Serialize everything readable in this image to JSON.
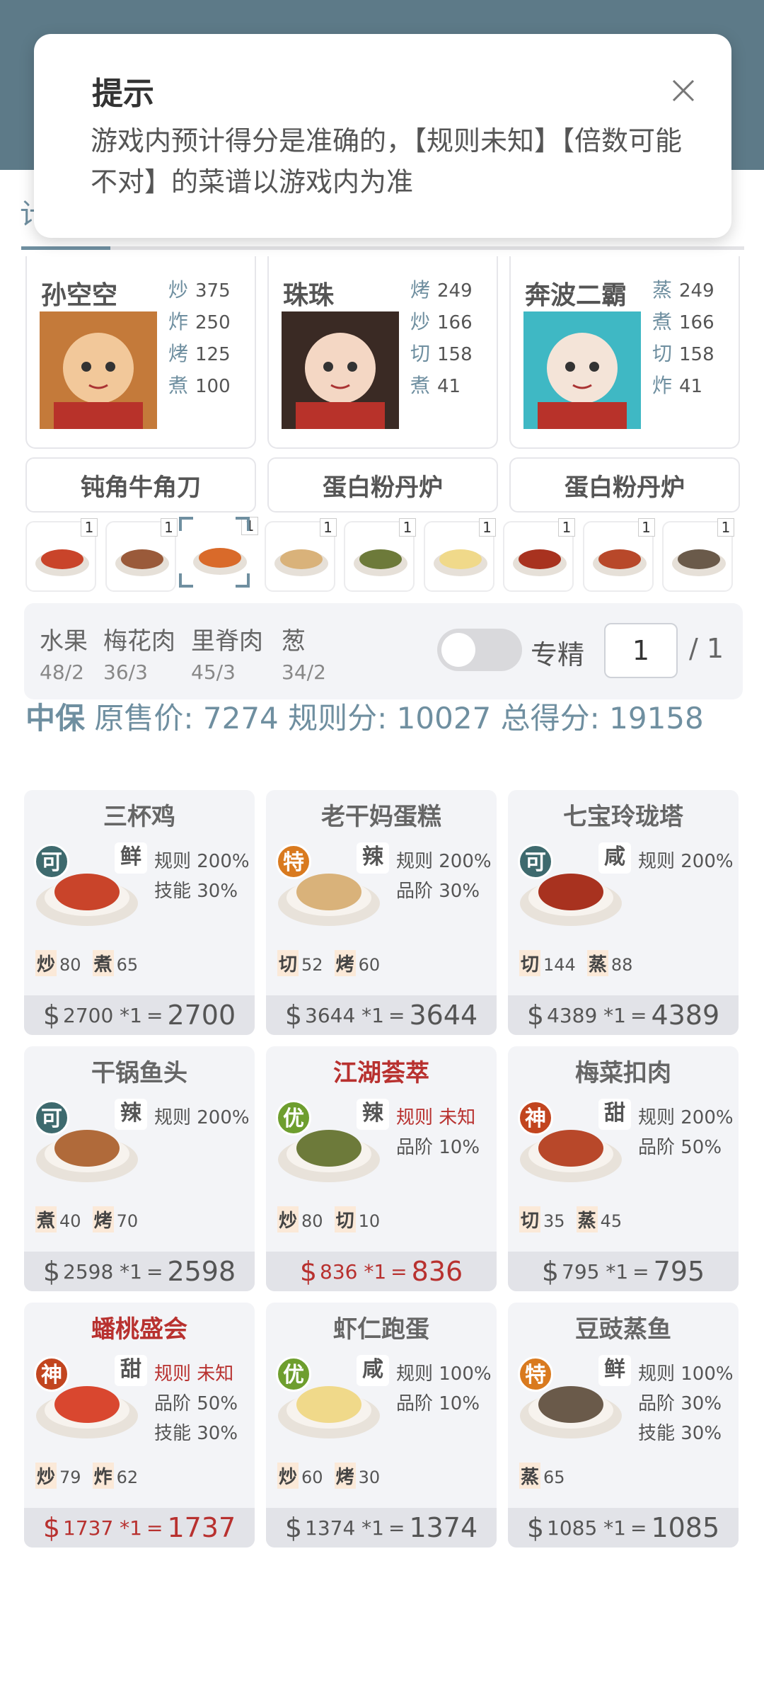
{
  "dialog": {
    "title": "提示",
    "message": "游戏内预计得分是准确的，【规则未知】【倍数可能不对】的菜谱以游戏内为准"
  },
  "tab_partial_char": "计",
  "chefs": [
    {
      "name": "孙空空",
      "skills": [
        {
          "k": "炒",
          "v": "375"
        },
        {
          "k": "炸",
          "v": "250"
        },
        {
          "k": "烤",
          "v": "125"
        },
        {
          "k": "煮",
          "v": "100"
        }
      ]
    },
    {
      "name": "珠珠",
      "skills": [
        {
          "k": "烤",
          "v": "249"
        },
        {
          "k": "炒",
          "v": "166"
        },
        {
          "k": "切",
          "v": "158"
        },
        {
          "k": "煮",
          "v": "41"
        }
      ]
    },
    {
      "name": "奔波二霸",
      "skills": [
        {
          "k": "蒸",
          "v": "249"
        },
        {
          "k": "煮",
          "v": "166"
        },
        {
          "k": "切",
          "v": "158"
        },
        {
          "k": "炸",
          "v": "41"
        }
      ]
    }
  ],
  "equipment": [
    "钝角牛角刀",
    "蛋白粉丹炉",
    "蛋白粉丹炉"
  ],
  "recipe_strip_qty": [
    "1",
    "1",
    "1",
    "1",
    "1",
    "1",
    "1",
    "1",
    "1"
  ],
  "materials": [
    {
      "name": "水果",
      "qty": "48/2"
    },
    {
      "name": "梅花肉",
      "qty": "36/3"
    },
    {
      "name": "里脊肉",
      "qty": "45/3"
    },
    {
      "name": "葱",
      "qty": "34/2"
    }
  ],
  "specialize": {
    "label": "专精",
    "value": "1",
    "total": "/ 1"
  },
  "score": {
    "grade": "中保",
    "original_label": "原售价:",
    "original": "7274",
    "rule_label": "规则分:",
    "rule": "10027",
    "total_label": "总得分:",
    "total": "19158"
  },
  "dishes": [
    {
      "name": "三杯鸡",
      "red": false,
      "rank": "可",
      "rank_cls": "ke",
      "taste": "鲜",
      "bonus": [
        "规则 200%",
        "技能 30%"
      ],
      "bonus_red": [
        false,
        false
      ],
      "reqs": [
        {
          "k": "炒",
          "v": "80"
        },
        {
          "k": "煮",
          "v": "65"
        }
      ],
      "calc": "2700 *1",
      "result": "2700",
      "price_red": false,
      "color": "#c9442a"
    },
    {
      "name": "老干妈蛋糕",
      "red": false,
      "rank": "特",
      "rank_cls": "te",
      "taste": "辣",
      "bonus": [
        "规则 200%",
        "品阶 30%"
      ],
      "bonus_red": [
        false,
        false
      ],
      "reqs": [
        {
          "k": "切",
          "v": "52"
        },
        {
          "k": "烤",
          "v": "60"
        }
      ],
      "calc": "3644 *1",
      "result": "3644",
      "price_red": false,
      "color": "#d9b27a"
    },
    {
      "name": "七宝玲珑塔",
      "red": false,
      "rank": "可",
      "rank_cls": "ke",
      "taste": "咸",
      "bonus": [
        "规则 200%"
      ],
      "bonus_red": [
        false
      ],
      "reqs": [
        {
          "k": "切",
          "v": "144"
        },
        {
          "k": "蒸",
          "v": "88"
        }
      ],
      "calc": "4389 *1",
      "result": "4389",
      "price_red": false,
      "color": "#a8321f"
    },
    {
      "name": "干锅鱼头",
      "red": false,
      "rank": "可",
      "rank_cls": "ke",
      "taste": "辣",
      "bonus": [
        "规则 200%"
      ],
      "bonus_red": [
        false
      ],
      "reqs": [
        {
          "k": "煮",
          "v": "40"
        },
        {
          "k": "烤",
          "v": "70"
        }
      ],
      "calc": "2598 *1",
      "result": "2598",
      "price_red": false,
      "color": "#b06a3a"
    },
    {
      "name": "江湖荟萃",
      "red": true,
      "rank": "优",
      "rank_cls": "you",
      "taste": "辣",
      "bonus": [
        "规则 未知",
        "品阶 10%"
      ],
      "bonus_red": [
        true,
        false
      ],
      "reqs": [
        {
          "k": "炒",
          "v": "80"
        },
        {
          "k": "切",
          "v": "10"
        }
      ],
      "calc": "836 *1",
      "result": "836",
      "price_red": true,
      "color": "#6d7a3a"
    },
    {
      "name": "梅菜扣肉",
      "red": false,
      "rank": "神",
      "rank_cls": "shen",
      "taste": "甜",
      "bonus": [
        "规则 200%",
        "品阶 50%"
      ],
      "bonus_red": [
        false,
        false
      ],
      "reqs": [
        {
          "k": "切",
          "v": "35"
        },
        {
          "k": "蒸",
          "v": "45"
        }
      ],
      "calc": "795 *1",
      "result": "795",
      "price_red": false,
      "color": "#b8482a"
    },
    {
      "name": "蟠桃盛会",
      "red": true,
      "rank": "神",
      "rank_cls": "shen",
      "taste": "甜",
      "bonus": [
        "规则 未知",
        "品阶 50%",
        "技能 30%"
      ],
      "bonus_red": [
        true,
        false,
        false
      ],
      "reqs": [
        {
          "k": "炒",
          "v": "79"
        },
        {
          "k": "炸",
          "v": "62"
        }
      ],
      "calc": "1737 *1",
      "result": "1737",
      "price_red": true,
      "color": "#d9472f"
    },
    {
      "name": "虾仁跑蛋",
      "red": false,
      "rank": "优",
      "rank_cls": "you",
      "taste": "咸",
      "bonus": [
        "规则 100%",
        "品阶 10%"
      ],
      "bonus_red": [
        false,
        false
      ],
      "reqs": [
        {
          "k": "炒",
          "v": "60"
        },
        {
          "k": "烤",
          "v": "30"
        }
      ],
      "calc": "1374 *1",
      "result": "1374",
      "price_red": false,
      "color": "#f0d98a"
    },
    {
      "name": "豆豉蒸鱼",
      "red": false,
      "rank": "特",
      "rank_cls": "te",
      "taste": "鲜",
      "bonus": [
        "规则 100%",
        "品阶 30%",
        "技能 30%"
      ],
      "bonus_red": [
        false,
        false,
        false
      ],
      "reqs": [
        {
          "k": "蒸",
          "v": "65"
        }
      ],
      "calc": "1085 *1",
      "result": "1085",
      "price_red": false,
      "color": "#6a5a4a"
    }
  ]
}
